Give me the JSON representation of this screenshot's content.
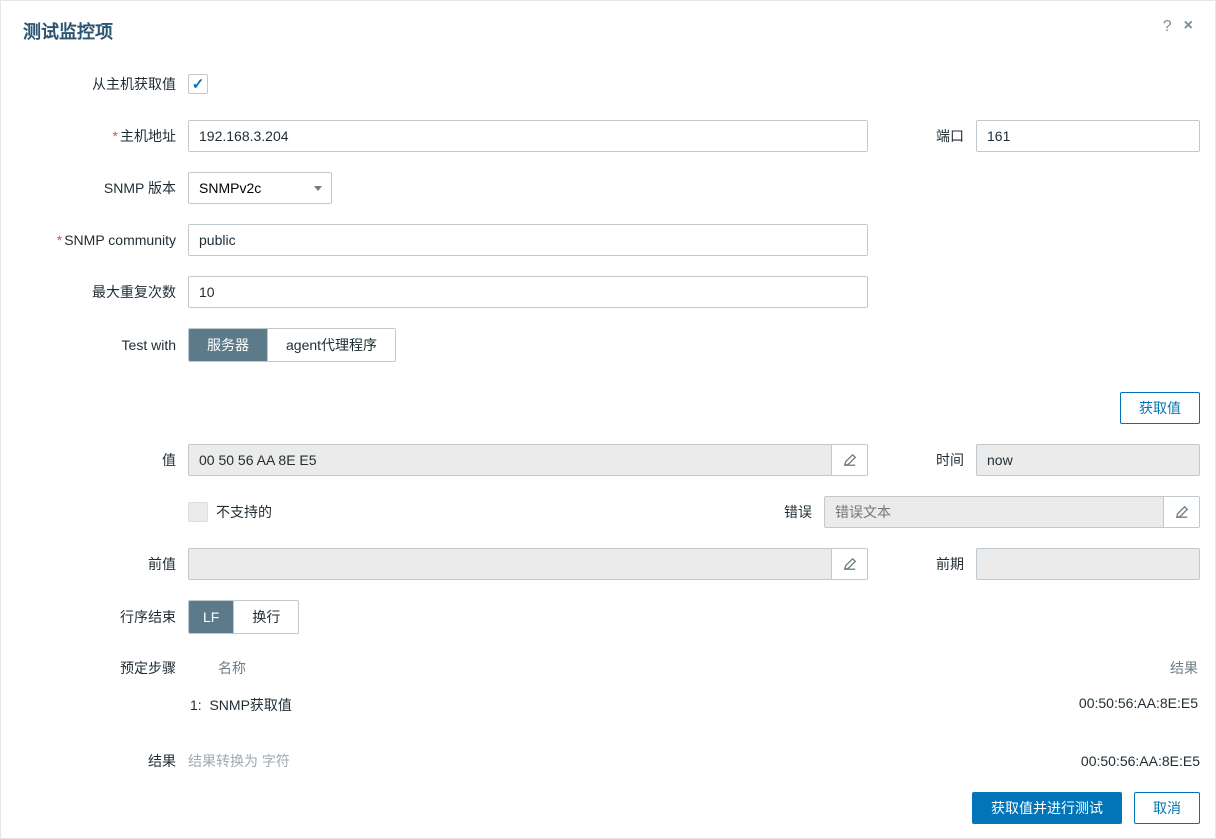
{
  "dialog": {
    "title": "测试监控项"
  },
  "labels": {
    "get_from_host": "从主机获取值",
    "host_addr": "主机地址",
    "port": "端口",
    "snmp_version": "SNMP 版本",
    "snmp_community": "SNMP community",
    "max_rep": "最大重复次数",
    "test_with": "Test with",
    "value": "值",
    "time": "时间",
    "not_supported": "不支持的",
    "error": "错误",
    "prev_value": "前值",
    "prev_time": "前期",
    "eol": "行序结束",
    "preset_steps": "预定步骤",
    "name_col": "名称",
    "result_col": "结果",
    "result": "结果"
  },
  "values": {
    "host_addr": "192.168.3.204",
    "port": "161",
    "snmp_version": "SNMPv2c",
    "snmp_community": "public",
    "max_rep": "10",
    "value": "00 50 56 AA 8E E5",
    "time": "now",
    "error_placeholder": "错误文本",
    "result_placeholder": "结果转换为 字符"
  },
  "seg": {
    "test_with": {
      "server": "服务器",
      "agent": "agent代理程序"
    },
    "eol": {
      "lf": "LF",
      "crlf": "换行"
    }
  },
  "buttons": {
    "get_value": "获取值",
    "get_and_test": "获取值并进行测试",
    "cancel": "取消"
  },
  "steps": [
    {
      "idx": "1:",
      "name": "SNMP获取值",
      "result": "00:50:56:AA:8E:E5"
    }
  ],
  "final_result": "00:50:56:AA:8E:E5"
}
